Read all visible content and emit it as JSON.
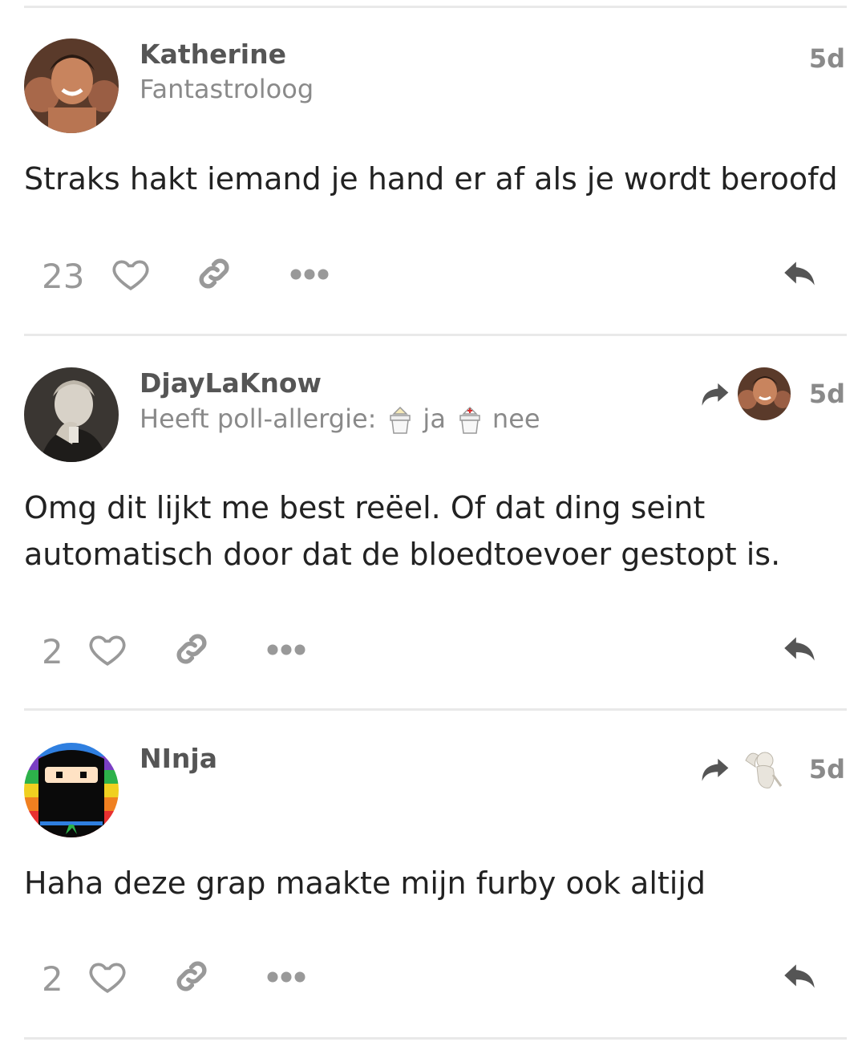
{
  "colors": {
    "text": "#222222",
    "muted": "#8a8a8a",
    "icon": "#999999",
    "reply_icon": "#555555",
    "divider": "#e9e9e9"
  },
  "posts": [
    {
      "author": "Katherine",
      "subtitle": "Fantastroloog",
      "time": "5d",
      "body": "Straks hakt iemand je hand er af als je wordt beroofd",
      "likes": "23",
      "icons": [
        "heart-icon",
        "link-icon",
        "more-icon",
        "reply-icon"
      ]
    },
    {
      "author": "DjayLaKnow",
      "subtitle": "Heeft poll-allergie:",
      "poll_options": [
        "ja",
        "nee"
      ],
      "time": "5d",
      "body": "Omg dit lijkt me best reëel. Of dat ding seint automatisch door dat de bloedtoevoer gestopt is.",
      "likes": "2",
      "reply_to_icon": "reply-to-arrow-icon",
      "icons": [
        "heart-icon",
        "link-icon",
        "more-icon",
        "reply-icon"
      ]
    },
    {
      "author": "NInja",
      "time": "5d",
      "body": "Haha deze grap maakte mijn furby ook altijd",
      "likes": "2",
      "reply_to_icon": "reply-to-arrow-icon",
      "icons": [
        "heart-icon",
        "link-icon",
        "more-icon",
        "reply-icon"
      ]
    }
  ]
}
